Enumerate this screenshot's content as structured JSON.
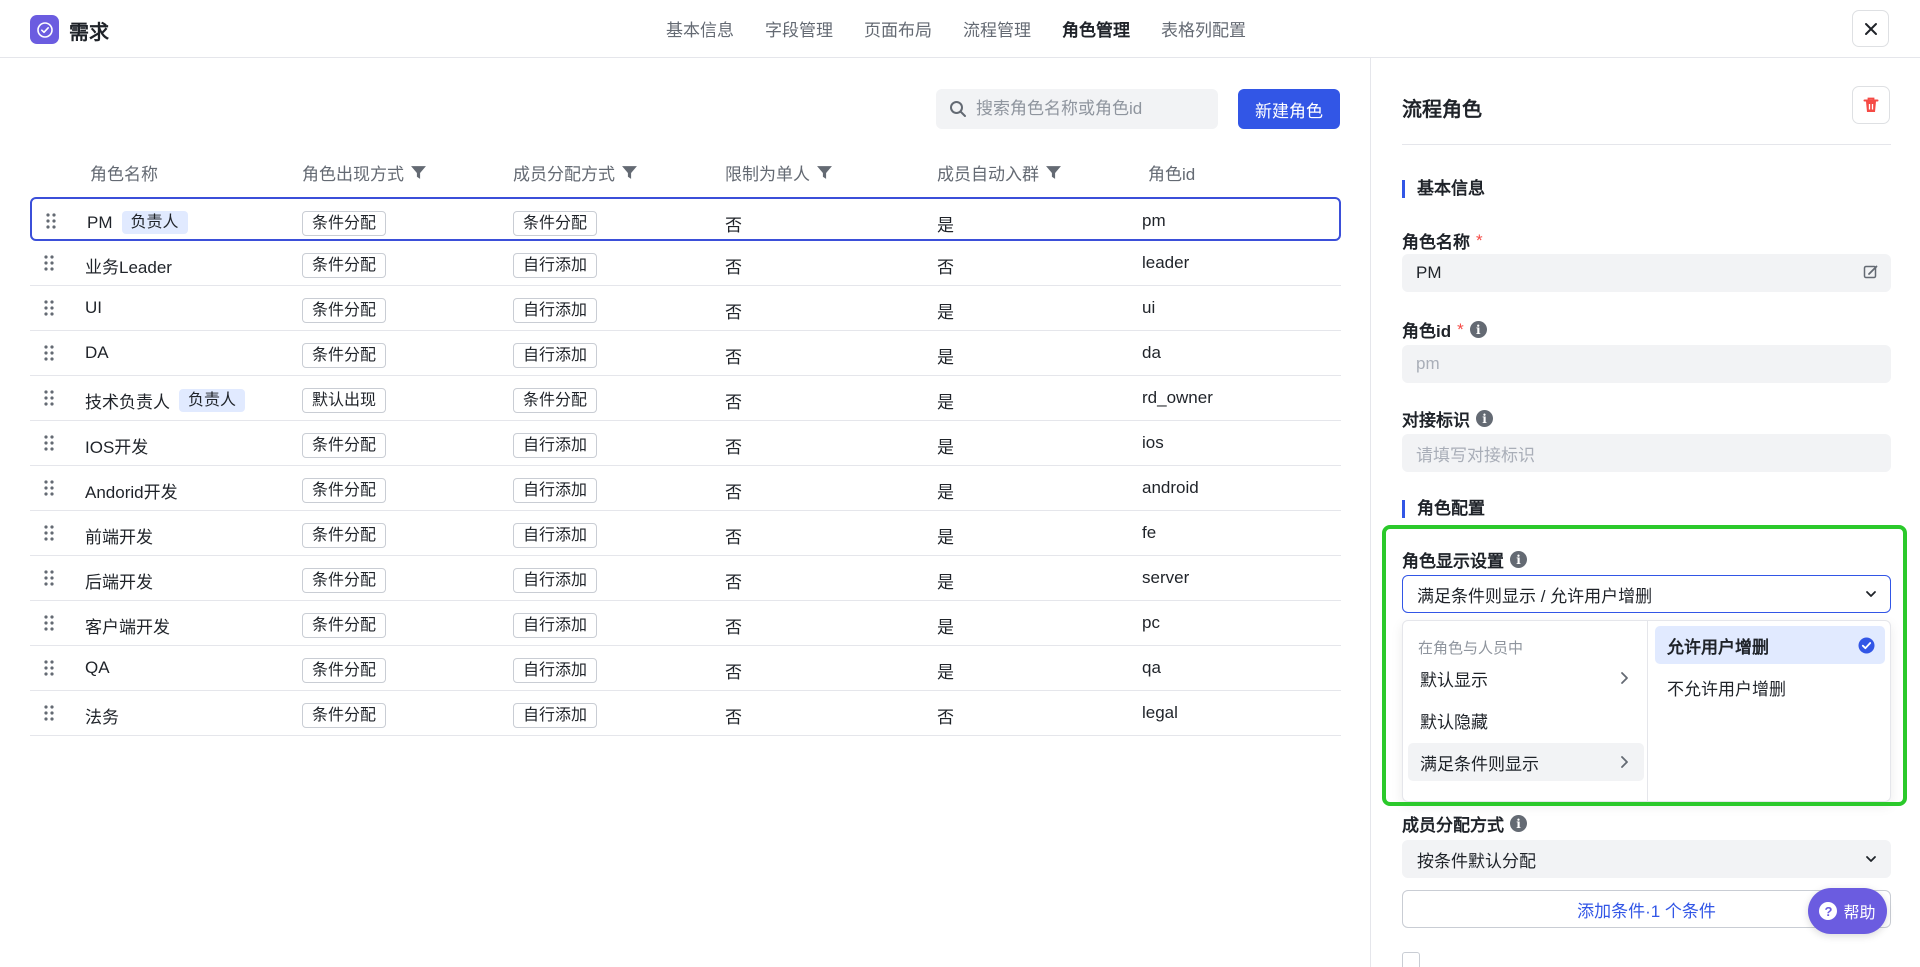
{
  "app": {
    "title": "需求"
  },
  "nav": {
    "tabs": [
      "基本信息",
      "字段管理",
      "页面布局",
      "流程管理",
      "角色管理",
      "表格列配置"
    ],
    "active": "角色管理"
  },
  "toolbar": {
    "search_placeholder": "搜索角色名称或角色id",
    "new_role_label": "新建角色"
  },
  "table": {
    "columns": [
      "角色名称",
      "角色出现方式",
      "成员分配方式",
      "限制为单人",
      "成员自动入群",
      "角色id"
    ],
    "owner_tag": "负责人",
    "rows": [
      {
        "name": "PM",
        "owner": true,
        "appear": "条件分配",
        "assign": "条件分配",
        "single": "否",
        "autojoin": "是",
        "id": "pm"
      },
      {
        "name": "业务Leader",
        "owner": false,
        "appear": "条件分配",
        "assign": "自行添加",
        "single": "否",
        "autojoin": "否",
        "id": "leader"
      },
      {
        "name": "UI",
        "owner": false,
        "appear": "条件分配",
        "assign": "自行添加",
        "single": "否",
        "autojoin": "是",
        "id": "ui"
      },
      {
        "name": "DA",
        "owner": false,
        "appear": "条件分配",
        "assign": "自行添加",
        "single": "否",
        "autojoin": "是",
        "id": "da"
      },
      {
        "name": "技术负责人",
        "owner": true,
        "appear": "默认出现",
        "assign": "条件分配",
        "single": "否",
        "autojoin": "是",
        "id": "rd_owner"
      },
      {
        "name": "IOS开发",
        "owner": false,
        "appear": "条件分配",
        "assign": "自行添加",
        "single": "否",
        "autojoin": "是",
        "id": "ios"
      },
      {
        "name": "Andorid开发",
        "owner": false,
        "appear": "条件分配",
        "assign": "自行添加",
        "single": "否",
        "autojoin": "是",
        "id": "android"
      },
      {
        "name": "前端开发",
        "owner": false,
        "appear": "条件分配",
        "assign": "自行添加",
        "single": "否",
        "autojoin": "是",
        "id": "fe"
      },
      {
        "name": "后端开发",
        "owner": false,
        "appear": "条件分配",
        "assign": "自行添加",
        "single": "否",
        "autojoin": "是",
        "id": "server"
      },
      {
        "name": "客户端开发",
        "owner": false,
        "appear": "条件分配",
        "assign": "自行添加",
        "single": "否",
        "autojoin": "是",
        "id": "pc"
      },
      {
        "name": "QA",
        "owner": false,
        "appear": "条件分配",
        "assign": "自行添加",
        "single": "否",
        "autojoin": "是",
        "id": "qa"
      },
      {
        "name": "法务",
        "owner": false,
        "appear": "条件分配",
        "assign": "自行添加",
        "single": "否",
        "autojoin": "否",
        "id": "legal"
      }
    ]
  },
  "panel": {
    "title": "流程角色",
    "basic_section": "基本信息",
    "role_name_label": "角色名称",
    "role_name_value": "PM",
    "role_id_label": "角色id",
    "role_id_value": "pm",
    "dock_label": "对接标识",
    "dock_placeholder": "请填写对接标识",
    "config_section": "角色配置",
    "display_label": "角色显示设置",
    "display_value": "满足条件则显示 / 允许用户增删",
    "dropdown": {
      "header": "在角色与人员中",
      "left": [
        "默认显示",
        "默认隐藏",
        "满足条件则显示"
      ],
      "right": [
        "允许用户增删",
        "不允许用户增删"
      ]
    },
    "assign_label": "成员分配方式",
    "assign_value": "按条件默认分配",
    "add_condition": "添加条件·1 个条件",
    "help": "帮助"
  },
  "colors": {
    "accent": "#3256e6",
    "brand": "#6b5ce0",
    "highlight": "#2bc92b",
    "danger": "#f54a45"
  }
}
